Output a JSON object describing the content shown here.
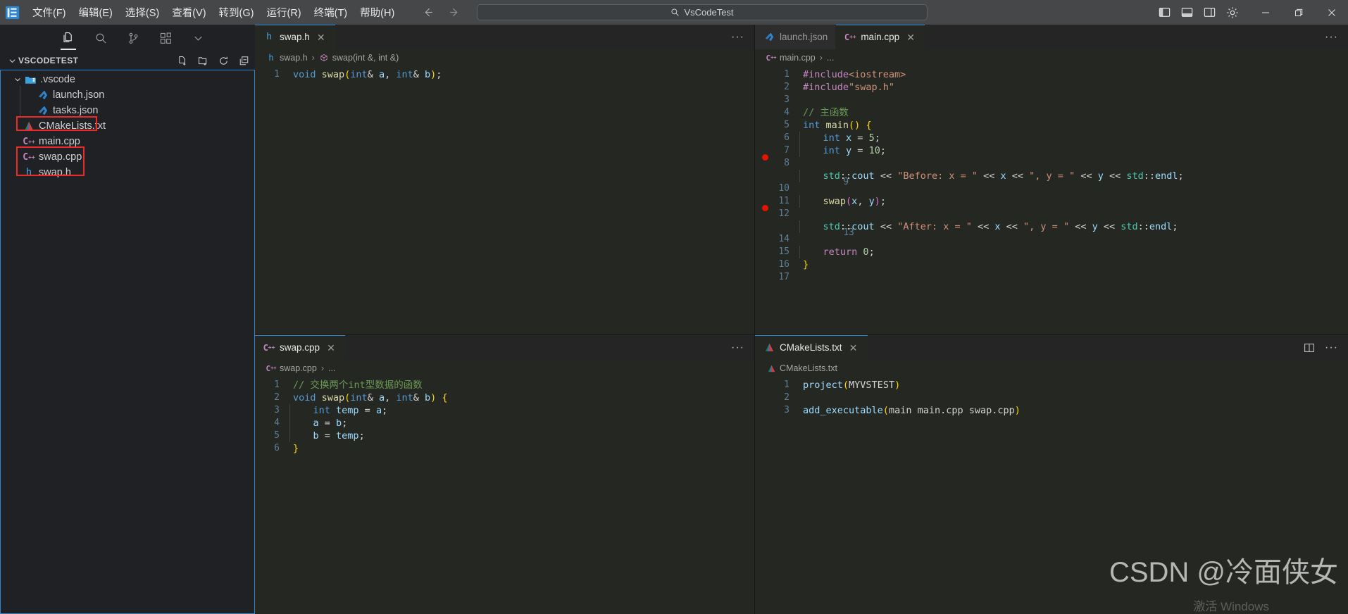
{
  "titlebar": {
    "logo_icon": "vscode-logo-icon",
    "menus": [
      {
        "label": "文件(F)",
        "name": "menu-file"
      },
      {
        "label": "编辑(E)",
        "name": "menu-edit"
      },
      {
        "label": "选择(S)",
        "name": "menu-selection"
      },
      {
        "label": "查看(V)",
        "name": "menu-view"
      },
      {
        "label": "转到(G)",
        "name": "menu-go"
      },
      {
        "label": "运行(R)",
        "name": "menu-run"
      },
      {
        "label": "终端(T)",
        "name": "menu-terminal"
      },
      {
        "label": "帮助(H)",
        "name": "menu-help"
      }
    ],
    "nav_back_icon": "arrow-left-icon",
    "nav_forward_icon": "arrow-right-icon",
    "quick_input_value": "VsCodeTest",
    "quick_input_icon": "search-icon",
    "layout_icons": [
      "toggle-primary-sidebar-icon",
      "toggle-panel-icon",
      "toggle-secondary-sidebar-icon",
      "customize-layout-gear-icon"
    ],
    "window_minimize": "—",
    "window_maximize": "❐",
    "window_close": "✕"
  },
  "activitybar": {
    "items": [
      {
        "name": "activity-explorer",
        "icon": "files-icon",
        "active": true
      },
      {
        "name": "activity-search",
        "icon": "search-icon",
        "active": false
      },
      {
        "name": "activity-source-control",
        "icon": "source-control-icon",
        "active": false
      },
      {
        "name": "activity-extensions",
        "icon": "extensions-icon",
        "active": false
      },
      {
        "name": "activity-more",
        "icon": "chevron-down-icon",
        "active": false
      }
    ]
  },
  "explorer": {
    "title": "VSCODETEST",
    "actions": [
      "new-file-icon",
      "new-folder-icon",
      "refresh-icon",
      "collapse-all-icon"
    ],
    "tree": [
      {
        "label": ".vscode",
        "icon": "folder-vscode-icon",
        "depth": 1,
        "expanded": true,
        "type": "folder"
      },
      {
        "label": "launch.json",
        "icon": "json-vscode-icon",
        "depth": 2,
        "type": "file"
      },
      {
        "label": "tasks.json",
        "icon": "json-vscode-icon",
        "depth": 2,
        "type": "file"
      },
      {
        "label": "CMakeLists.txt",
        "icon": "cmake-icon",
        "depth": 1,
        "type": "file",
        "highlighted": true
      },
      {
        "label": "main.cpp",
        "icon": "cpp-icon",
        "depth": 1,
        "type": "file"
      },
      {
        "label": "swap.cpp",
        "icon": "cpp-icon",
        "depth": 1,
        "type": "file",
        "highlighted": true
      },
      {
        "label": "swap.h",
        "icon": "h-icon",
        "depth": 1,
        "type": "file",
        "highlighted": true
      }
    ]
  },
  "editor_groups": {
    "top_left": {
      "tabs": [
        {
          "label": "swap.h",
          "icon": "h-icon",
          "active": true,
          "close": "✕"
        }
      ],
      "breadcrumb": {
        "file": "swap.h",
        "file_icon": "h-icon",
        "symbol": "swap(int &, int &)",
        "symbol_icon": "method-icon",
        "separator": "›"
      },
      "overflow_icon": "ellipsis-icon",
      "lines": [
        {
          "n": "1",
          "tokens": [
            {
              "t": "void ",
              "c": "kw"
            },
            {
              "t": "swap",
              "c": "fn"
            },
            {
              "t": "(",
              "c": "brk"
            },
            {
              "t": "int",
              "c": "kw"
            },
            {
              "t": "& ",
              "c": "pun"
            },
            {
              "t": "a",
              "c": "var"
            },
            {
              "t": ", ",
              "c": "pun"
            },
            {
              "t": "int",
              "c": "kw"
            },
            {
              "t": "& ",
              "c": "pun"
            },
            {
              "t": "b",
              "c": "var"
            },
            {
              "t": ")",
              "c": "brk"
            },
            {
              "t": ";",
              "c": "pun"
            }
          ]
        }
      ]
    },
    "bottom_left": {
      "tabs": [
        {
          "label": "swap.cpp",
          "icon": "cpp-icon",
          "active": true,
          "close": "✕"
        }
      ],
      "breadcrumb": {
        "file": "swap.cpp",
        "file_icon": "cpp-icon",
        "symbol": "...",
        "separator": "›"
      },
      "overflow_icon": "ellipsis-icon",
      "lines": [
        {
          "n": "1",
          "tokens": [
            {
              "t": "// 交换两个int型数据的函数",
              "c": "cmt"
            }
          ]
        },
        {
          "n": "2",
          "tokens": [
            {
              "t": "void ",
              "c": "kw"
            },
            {
              "t": "swap",
              "c": "fn"
            },
            {
              "t": "(",
              "c": "brk"
            },
            {
              "t": "int",
              "c": "kw"
            },
            {
              "t": "& ",
              "c": "pun"
            },
            {
              "t": "a",
              "c": "var"
            },
            {
              "t": ", ",
              "c": "pun"
            },
            {
              "t": "int",
              "c": "kw"
            },
            {
              "t": "& ",
              "c": "pun"
            },
            {
              "t": "b",
              "c": "var"
            },
            {
              "t": ")",
              "c": "brk"
            },
            {
              "t": " ",
              "c": "pun"
            },
            {
              "t": "{",
              "c": "brk"
            }
          ]
        },
        {
          "n": "3",
          "indent": 1,
          "tokens": [
            {
              "t": "    ",
              "c": "pun"
            },
            {
              "t": "int ",
              "c": "kw"
            },
            {
              "t": "temp",
              "c": "var"
            },
            {
              "t": " = ",
              "c": "pun"
            },
            {
              "t": "a",
              "c": "var"
            },
            {
              "t": ";",
              "c": "pun"
            }
          ]
        },
        {
          "n": "4",
          "indent": 1,
          "tokens": [
            {
              "t": "    ",
              "c": "pun"
            },
            {
              "t": "a",
              "c": "var"
            },
            {
              "t": " = ",
              "c": "pun"
            },
            {
              "t": "b",
              "c": "var"
            },
            {
              "t": ";",
              "c": "pun"
            }
          ]
        },
        {
          "n": "5",
          "indent": 1,
          "tokens": [
            {
              "t": "    ",
              "c": "pun"
            },
            {
              "t": "b",
              "c": "var"
            },
            {
              "t": " = ",
              "c": "pun"
            },
            {
              "t": "temp",
              "c": "var"
            },
            {
              "t": ";",
              "c": "pun"
            }
          ]
        },
        {
          "n": "6",
          "tokens": [
            {
              "t": "}",
              "c": "brk"
            }
          ]
        }
      ]
    },
    "top_right": {
      "tabs": [
        {
          "label": "launch.json",
          "icon": "json-vscode-icon",
          "active": false
        },
        {
          "label": "main.cpp",
          "icon": "cpp-icon",
          "active": true,
          "close": "✕"
        }
      ],
      "breadcrumb": {
        "file": "main.cpp",
        "file_icon": "cpp-icon",
        "symbol": "...",
        "separator": "›"
      },
      "overflow_icon": "ellipsis-icon",
      "lines": [
        {
          "n": "1",
          "tokens": [
            {
              "t": "#include",
              "c": "pp"
            },
            {
              "t": "<iostream>",
              "c": "str"
            }
          ]
        },
        {
          "n": "2",
          "tokens": [
            {
              "t": "#include",
              "c": "pp"
            },
            {
              "t": "\"swap.h\"",
              "c": "str"
            }
          ]
        },
        {
          "n": "3",
          "tokens": []
        },
        {
          "n": "4",
          "tokens": [
            {
              "t": "// 主函数",
              "c": "cmt"
            }
          ]
        },
        {
          "n": "5",
          "tokens": [
            {
              "t": "int ",
              "c": "kw"
            },
            {
              "t": "main",
              "c": "fn"
            },
            {
              "t": "()",
              "c": "brk"
            },
            {
              "t": " ",
              "c": "pun"
            },
            {
              "t": "{",
              "c": "brk"
            }
          ]
        },
        {
          "n": "6",
          "indent": 1,
          "tokens": [
            {
              "t": "    ",
              "c": "pun"
            },
            {
              "t": "int ",
              "c": "kw"
            },
            {
              "t": "x",
              "c": "var"
            },
            {
              "t": " = ",
              "c": "pun"
            },
            {
              "t": "5",
              "c": "num"
            },
            {
              "t": ";",
              "c": "pun"
            }
          ]
        },
        {
          "n": "7",
          "indent": 1,
          "tokens": [
            {
              "t": "    ",
              "c": "pun"
            },
            {
              "t": "int ",
              "c": "kw"
            },
            {
              "t": "y",
              "c": "var"
            },
            {
              "t": " = ",
              "c": "pun"
            },
            {
              "t": "10",
              "c": "num"
            },
            {
              "t": ";",
              "c": "pun"
            }
          ]
        },
        {
          "n": "8",
          "indent": 1,
          "tokens": []
        },
        {
          "n": "9",
          "indent": 1,
          "breakpoint": true,
          "tokens": [
            {
              "t": "    ",
              "c": "pun"
            },
            {
              "t": "std",
              "c": "typ"
            },
            {
              "t": "::",
              "c": "pun"
            },
            {
              "t": "cout",
              "c": "var"
            },
            {
              "t": " << ",
              "c": "pun"
            },
            {
              "t": "\"Before: x = \"",
              "c": "str"
            },
            {
              "t": " << ",
              "c": "pun"
            },
            {
              "t": "x",
              "c": "var"
            },
            {
              "t": " << ",
              "c": "pun"
            },
            {
              "t": "\", y = \"",
              "c": "str"
            },
            {
              "t": " << ",
              "c": "pun"
            },
            {
              "t": "y",
              "c": "var"
            },
            {
              "t": " << ",
              "c": "pun"
            },
            {
              "t": "std",
              "c": "typ"
            },
            {
              "t": "::",
              "c": "pun"
            },
            {
              "t": "endl",
              "c": "var"
            },
            {
              "t": ";",
              "c": "pun"
            }
          ]
        },
        {
          "n": "10",
          "indent": 1,
          "tokens": []
        },
        {
          "n": "11",
          "indent": 1,
          "tokens": [
            {
              "t": "    ",
              "c": "pun"
            },
            {
              "t": "swap",
              "c": "fn"
            },
            {
              "t": "(",
              "c": "brk2"
            },
            {
              "t": "x",
              "c": "var"
            },
            {
              "t": ", ",
              "c": "pun"
            },
            {
              "t": "y",
              "c": "var"
            },
            {
              "t": ")",
              "c": "brk2"
            },
            {
              "t": ";",
              "c": "pun"
            }
          ]
        },
        {
          "n": "12",
          "indent": 1,
          "tokens": []
        },
        {
          "n": "13",
          "indent": 1,
          "breakpoint": true,
          "tokens": [
            {
              "t": "    ",
              "c": "pun"
            },
            {
              "t": "std",
              "c": "typ"
            },
            {
              "t": "::",
              "c": "pun"
            },
            {
              "t": "cout",
              "c": "var"
            },
            {
              "t": " << ",
              "c": "pun"
            },
            {
              "t": "\"After: x = \"",
              "c": "str"
            },
            {
              "t": " << ",
              "c": "pun"
            },
            {
              "t": "x",
              "c": "var"
            },
            {
              "t": " << ",
              "c": "pun"
            },
            {
              "t": "\", y = \"",
              "c": "str"
            },
            {
              "t": " << ",
              "c": "pun"
            },
            {
              "t": "y",
              "c": "var"
            },
            {
              "t": " << ",
              "c": "pun"
            },
            {
              "t": "std",
              "c": "typ"
            },
            {
              "t": "::",
              "c": "pun"
            },
            {
              "t": "endl",
              "c": "var"
            },
            {
              "t": ";",
              "c": "pun"
            }
          ]
        },
        {
          "n": "14",
          "indent": 1,
          "tokens": []
        },
        {
          "n": "15",
          "indent": 1,
          "tokens": [
            {
              "t": "    ",
              "c": "pun"
            },
            {
              "t": "return ",
              "c": "kw2"
            },
            {
              "t": "0",
              "c": "num"
            },
            {
              "t": ";",
              "c": "pun"
            }
          ]
        },
        {
          "n": "16",
          "tokens": [
            {
              "t": "}",
              "c": "brk"
            }
          ]
        },
        {
          "n": "17",
          "tokens": []
        }
      ]
    },
    "bottom_right": {
      "tabs": [
        {
          "label": "CMakeLists.txt",
          "icon": "cmake-icon",
          "active": true,
          "close": "✕"
        }
      ],
      "breadcrumb": {
        "file": "CMakeLists.txt",
        "file_icon": "cmake-icon",
        "symbol": "",
        "separator": ""
      },
      "split_icon": "split-editor-icon",
      "overflow_icon": "ellipsis-icon",
      "lines": [
        {
          "n": "1",
          "tokens": [
            {
              "t": "project",
              "c": "var"
            },
            {
              "t": "(",
              "c": "brk"
            },
            {
              "t": "MYVSTEST",
              "c": "txt"
            },
            {
              "t": ")",
              "c": "brk"
            }
          ]
        },
        {
          "n": "2",
          "tokens": []
        },
        {
          "n": "3",
          "tokens": [
            {
              "t": "add_executable",
              "c": "var"
            },
            {
              "t": "(",
              "c": "brk"
            },
            {
              "t": "main main.cpp swap.cpp",
              "c": "txt"
            },
            {
              "t": ")",
              "c": "brk"
            }
          ]
        }
      ]
    }
  },
  "overlay": {
    "watermark": "CSDN @冷面侠女",
    "activate_windows": "激活 Windows"
  },
  "colors": {
    "accent": "#2f86d0",
    "annotation_red": "#ee2b26",
    "breakpoint_red": "#e51400",
    "titlebar_bg": "#454749",
    "sidebar_bg": "#202124",
    "editor_bg": "#252723"
  }
}
